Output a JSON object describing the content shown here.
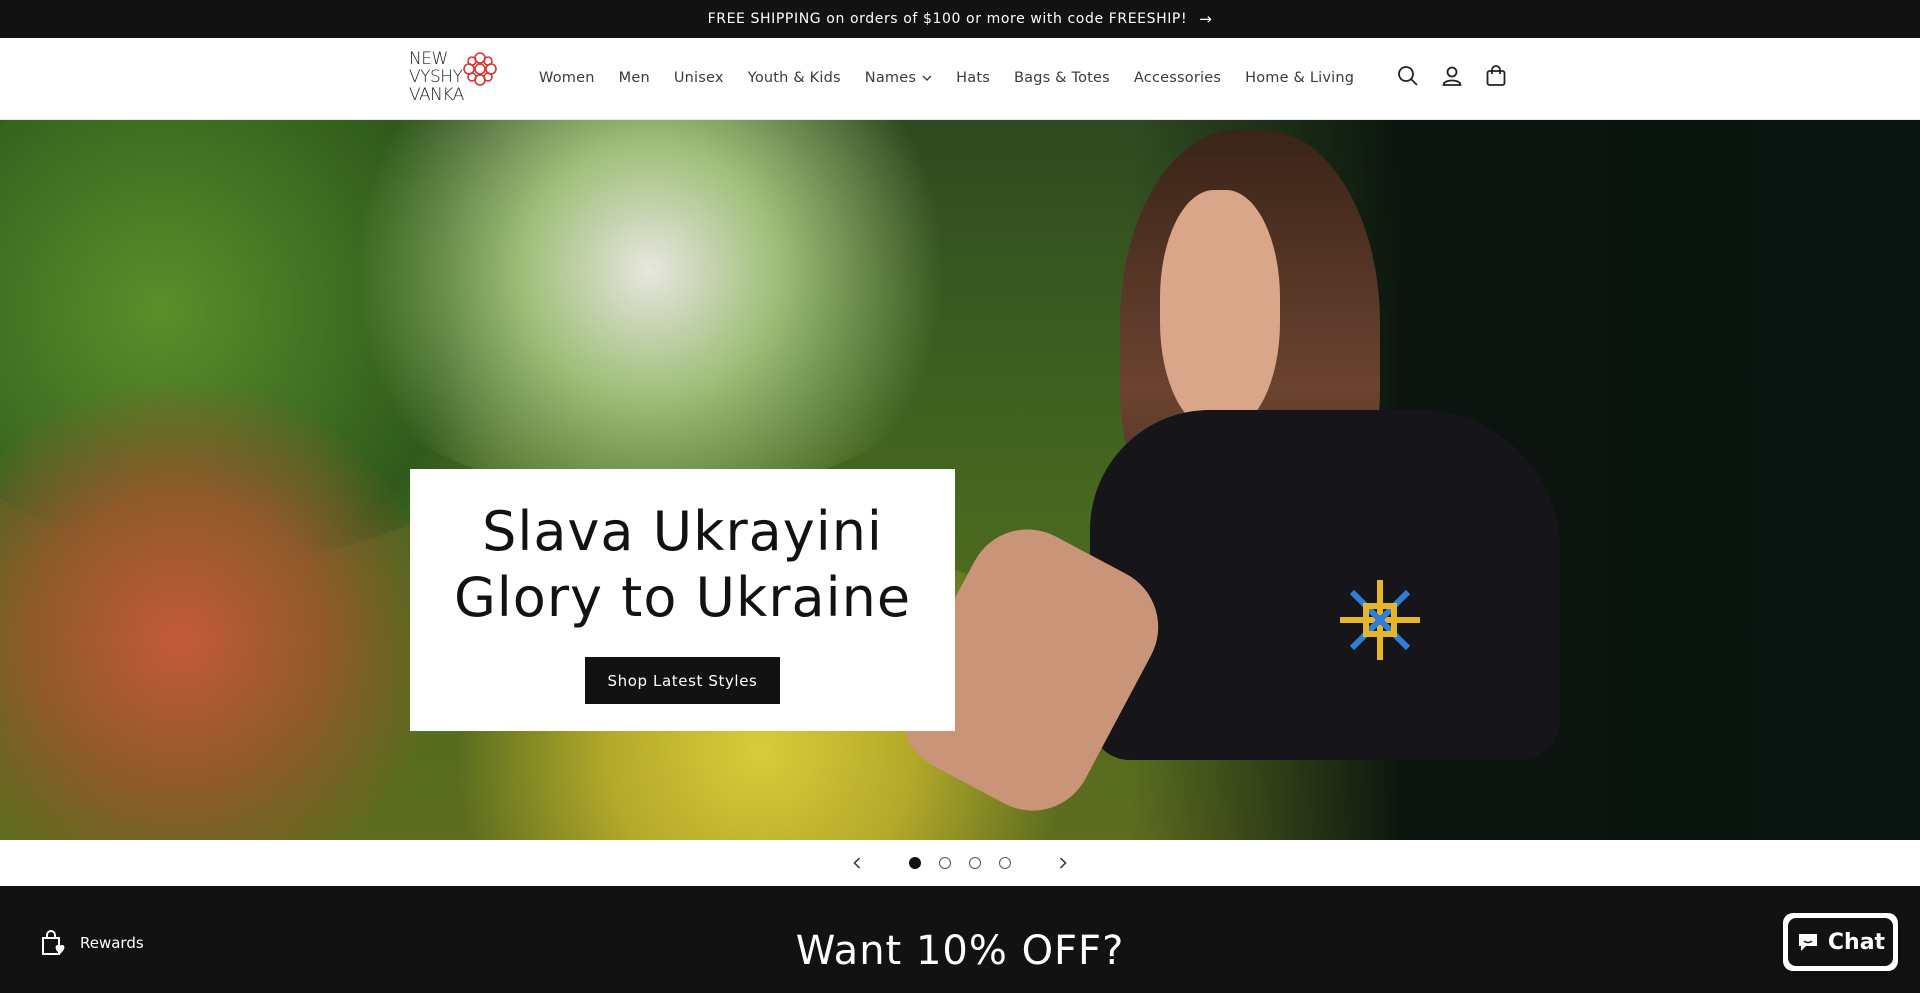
{
  "announcement": {
    "text": "FREE SHIPPING on orders of $100 or more with code FREESHIP!",
    "arrow_icon": "arrow-right-icon"
  },
  "header": {
    "logo": {
      "lines": [
        "NEW",
        "VYSHY",
        "VANKA"
      ],
      "accent_color": "#d8342f"
    },
    "nav": [
      {
        "label": "Women"
      },
      {
        "label": "Men"
      },
      {
        "label": "Unisex"
      },
      {
        "label": "Youth & Kids"
      },
      {
        "label": "Names",
        "has_dropdown": true
      },
      {
        "label": "Hats"
      },
      {
        "label": "Bags & Totes"
      },
      {
        "label": "Accessories"
      },
      {
        "label": "Home & Living"
      }
    ],
    "icons": [
      "search-icon",
      "account-icon",
      "cart-icon"
    ]
  },
  "hero": {
    "title_line1": "Slava Ukrayini",
    "title_line2": "Glory to Ukraine",
    "button_label": "Shop Latest Styles"
  },
  "slider": {
    "total": 4,
    "active": 1
  },
  "newsletter": {
    "heading": "Want 10% OFF?"
  },
  "rewards": {
    "label": "Rewards"
  },
  "chat": {
    "label": "Chat"
  },
  "colors": {
    "dark": "#121212",
    "white": "#ffffff"
  }
}
